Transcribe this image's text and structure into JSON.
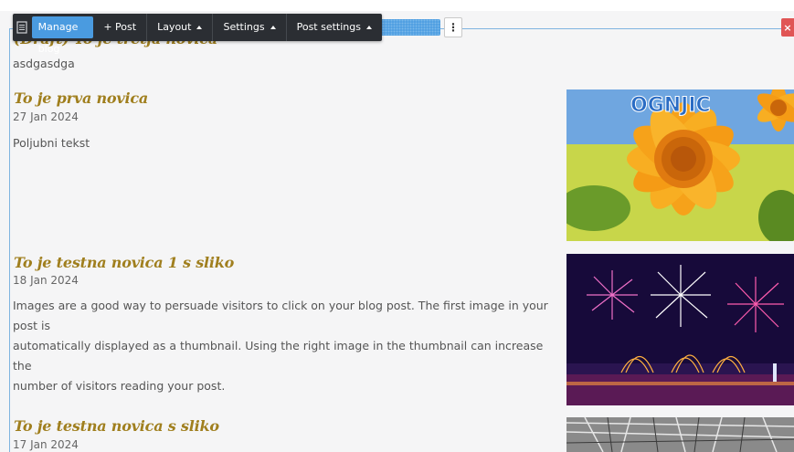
{
  "toolbar": {
    "manage_label": "Manage blog",
    "post_label": "+ Post",
    "layout_label": "Layout",
    "settings_label": "Settings",
    "post_settings_label": "Post settings"
  },
  "controls": {
    "more_glyph": "⋮",
    "close_glyph": "×"
  },
  "posts": [
    {
      "title": "(Draft) To je tretja novica",
      "excerpt": "asdgasdga"
    },
    {
      "title": "To je prva novica",
      "date": "27 Jan 2024",
      "excerpt": "Poljubni tekst",
      "image": "orange-flower-photo",
      "image_text": "OGNJIC"
    },
    {
      "title": "To je testna novica 1 s sliko",
      "date": "18 Jan 2024",
      "excerpt_lines": [
        "Images are a good way to persuade visitors to click on your blog post. The first image in your post is",
        "automatically displayed as a thumbnail. Using the right image in the thumbnail can increase the",
        "number of visitors reading your post."
      ],
      "image": "fireworks-photo"
    },
    {
      "title": "To je testna novica s sliko",
      "date": "17 Jan 2024",
      "image": "bw-architecture-photo"
    }
  ],
  "colors": {
    "title": "#a07f1e",
    "accent": "#4a9be0",
    "toolbar_bg": "#2b2e33",
    "close": "#e05555"
  }
}
